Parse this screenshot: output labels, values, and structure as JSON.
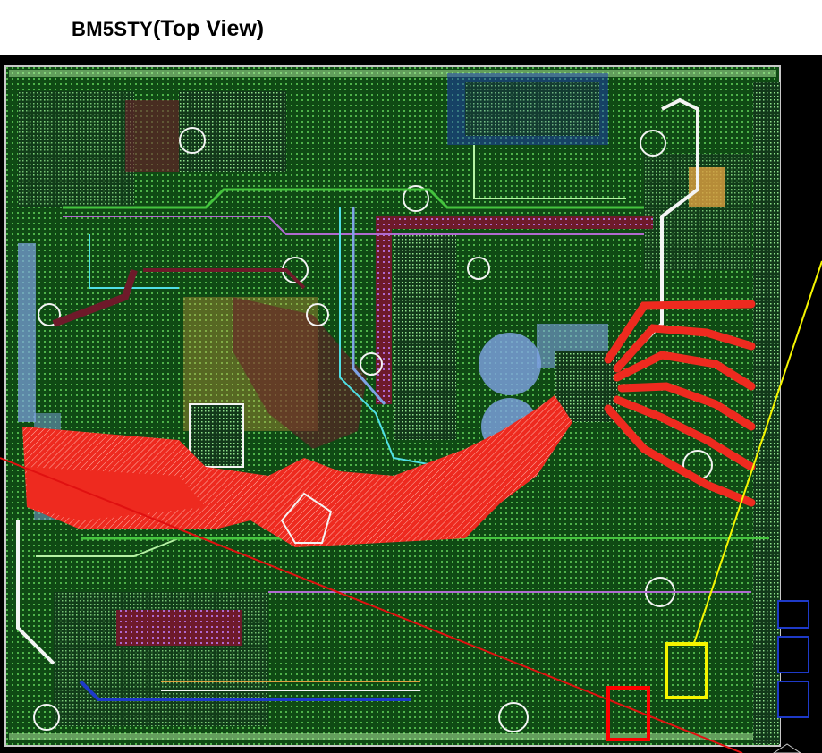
{
  "title": {
    "main": "BM5STY",
    "view": "(Top View)"
  },
  "colors": {
    "board_bg": "#000000",
    "substrate": "#0f4a14",
    "trace_green": "#45c43e",
    "trace_light": "#b6f2a4",
    "trace_blue": "#7fa3e6",
    "trace_cyan": "#50e0e6",
    "trace_white": "#f4f4f4",
    "trace_purple": "#b06ad0",
    "trace_orange": "#e0a040",
    "plane_red": "#ee2a1f",
    "plane_maroon": "#6e1a2a",
    "highlight_yellow": "#f5f500",
    "highlight_red": "#ff0000",
    "pointer_red": "#e01010",
    "connector_blue": "#1e3ac8"
  },
  "annotations": {
    "yellow_box": "yellow-highlight-box",
    "red_box": "red-highlight-box"
  }
}
